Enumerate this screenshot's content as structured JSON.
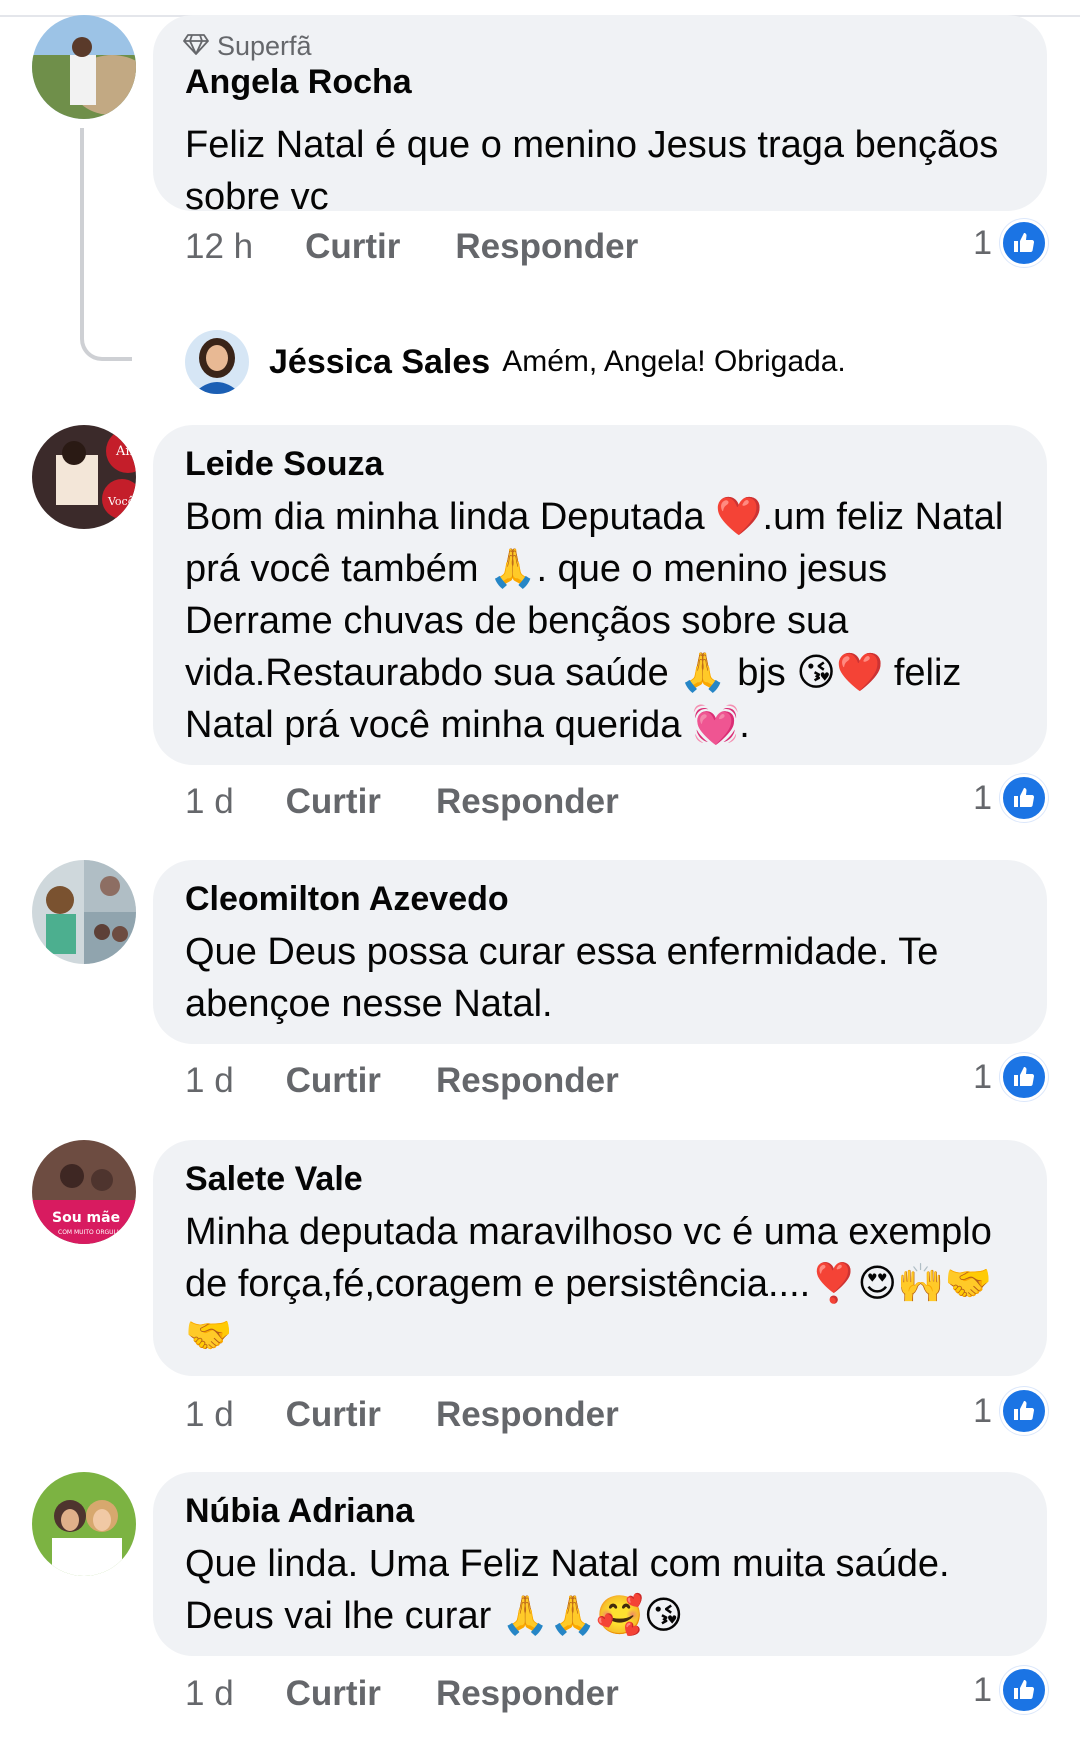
{
  "comments": [
    {
      "badge": "Superfã",
      "author": "Angela Rocha",
      "text": "Feliz Natal é que o menino Jesus traga bençãos sobre vc",
      "time": "12 h",
      "like_label": "Curtir",
      "reply_label": "Responder",
      "reaction_count": "1",
      "reply": {
        "author": "Jéssica Sales",
        "text": "Amém, Angela! Obrigada."
      }
    },
    {
      "author": "Leide Souza",
      "text": "Bom dia minha linda Deputada ❤️.um feliz Natal prá você também 🙏. que o menino jesus Derrame chuvas de bençãos sobre sua vida.Restaurabdo sua saúde 🙏 bjs 😘❤️ feliz Natal prá você minha querida 💓.",
      "time": "1 d",
      "like_label": "Curtir",
      "reply_label": "Responder",
      "reaction_count": "1"
    },
    {
      "author": "Cleomilton Azevedo",
      "text": "Que Deus possa curar essa enfermidade. Te abençoe nesse Natal.",
      "time": "1 d",
      "like_label": "Curtir",
      "reply_label": "Responder",
      "reaction_count": "1"
    },
    {
      "author": "Salete Vale",
      "text": "Minha deputada maravilhoso vc é uma exemplo de força,fé,coragem e persistência....❣️😍🙌🤝🤝",
      "time": "1 d",
      "like_label": "Curtir",
      "reply_label": "Responder",
      "reaction_count": "1"
    },
    {
      "author": "Núbia Adriana",
      "text": "Que linda. Uma Feliz Natal com muita saúde. Deus vai lhe curar 🙏🙏🥰😘",
      "time": "1 d",
      "like_label": "Curtir",
      "reply_label": "Responder",
      "reaction_count": "1"
    }
  ],
  "avatar_text": {
    "leide": [
      "Am",
      "Você"
    ],
    "salete": [
      "Sou mãe",
      "COM MUITO ORGULHO"
    ]
  },
  "colors": {
    "bubble": "#f0f2f5",
    "secondary_text": "#65676b",
    "like_blue": "#1b74e4",
    "thread_line": "#ced0d4"
  },
  "icons": {
    "badge": "diamond-icon",
    "reaction": "thumbs-up-icon"
  }
}
